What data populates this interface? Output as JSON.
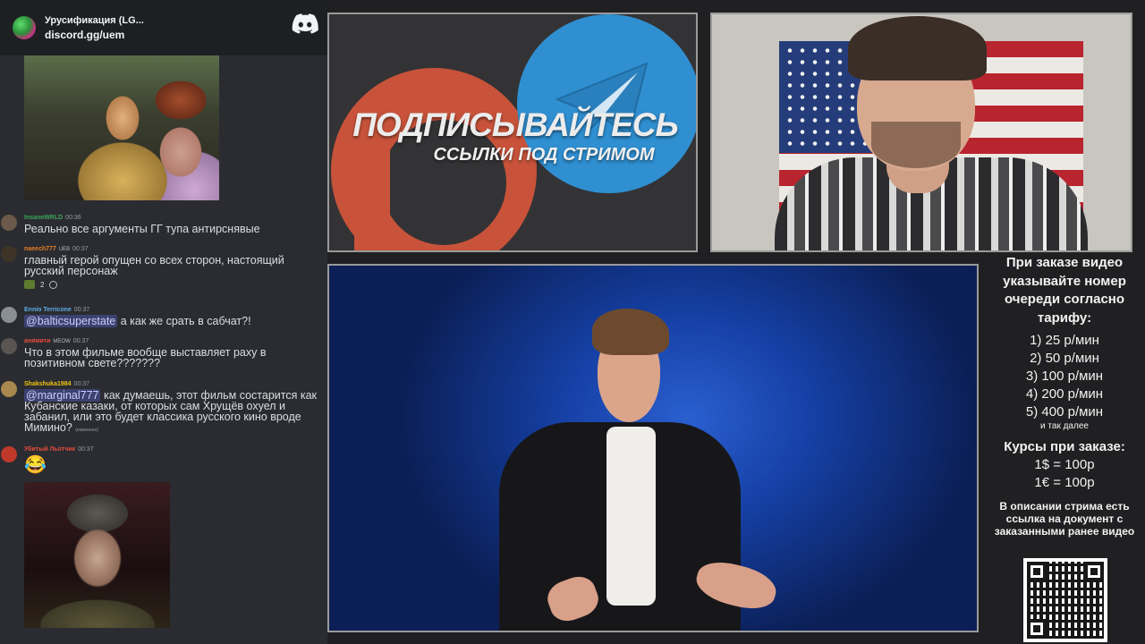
{
  "discord": {
    "server_name": "Урусификация (LG...",
    "invite": "discord.gg/uem",
    "icon": "discord-icon"
  },
  "chat": {
    "messages": [
      {
        "user": "InsaneWRLD",
        "user_color": "#3ba55d",
        "time": "00:36",
        "text": "Реально все аргументы ГГ тупа антирснявые"
      },
      {
        "user": "naeech777",
        "user_color": "#e67e22",
        "badge": "UEB",
        "time": "00:37",
        "text": "главный герой опущен со всех сторон, настоящий русский персонаж",
        "reaction_count": "2"
      },
      {
        "user": "Ennio Terricone",
        "user_color": "#5dade2",
        "time": "00:37",
        "mention": "@balticsuperstate",
        "text": "а как же срать в сабчат?!"
      },
      {
        "user": "анямити",
        "user_color": "#e74c3c",
        "badge": "MEOW",
        "time": "00:37",
        "text": "Что в этом фильме вообще выставляет раху в позитивном свете???????"
      },
      {
        "user": "Shakshuka1984",
        "user_color": "#f1c40f",
        "time": "00:37",
        "mention": "@marginal777",
        "text": "как думаешь, этот фильм состарится как Кубанские казаки, от которых сам Хрущёв охуел и забанил, или это будет классика русского кино вроде Мимино?",
        "edited": "(изменено)"
      },
      {
        "user": "Убитый Льотчик",
        "user_color": "#e74c3c",
        "time": "00:37",
        "emoji": "😂"
      }
    ]
  },
  "promo": {
    "title": "ПОДПИСЫВАЙТЕСЬ",
    "subtitle": "ССЫЛКИ ПОД СТРИМОМ"
  },
  "tariff": {
    "intro": "При заказе видео указывайте номер очереди согласно тарифу:",
    "prices": [
      "1) 25 р/мин",
      "2) 50 р/мин",
      "3) 100 р/мин",
      "4) 200 р/мин",
      "5) 400 р/мин"
    ],
    "etc": "и так далее",
    "rates_title": "Курсы при заказе:",
    "rate_usd": "1$ = 100р",
    "rate_eur": "1€ = 100р",
    "description": "В описании стрима есть ссылка на документ с заказанными ранее видео"
  },
  "colors": {
    "chat_bg": "#2b2c31",
    "patreon": "#c8533a",
    "telegram": "#2f8fd1",
    "mention_bg": "#3c4270"
  }
}
